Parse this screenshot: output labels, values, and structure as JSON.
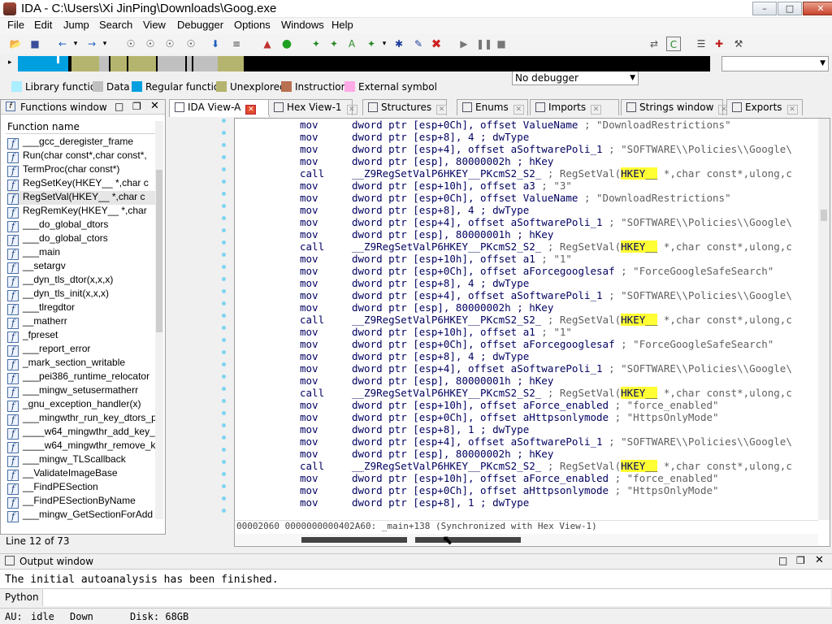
{
  "window": {
    "title": "IDA - C:\\Users\\Xi JinPing\\Downloads\\Goog.exe"
  },
  "menu": [
    "File",
    "Edit",
    "Jump",
    "Search",
    "View",
    "Debugger",
    "Options",
    "Windows",
    "Help"
  ],
  "toolbar": {
    "debugger_select": "No debugger"
  },
  "legend": [
    {
      "label": "Library function",
      "color": "#aaeeff"
    },
    {
      "label": "Data",
      "color": "#c0c0c0"
    },
    {
      "label": "Regular function",
      "color": "#00a0e0"
    },
    {
      "label": "Unexplored",
      "color": "#b4b46e"
    },
    {
      "label": "Instruction",
      "color": "#b87050"
    },
    {
      "label": "External symbol",
      "color": "#ffaae6"
    }
  ],
  "functions_window": {
    "title": "Functions window",
    "column": "Function name",
    "items": [
      "___gcc_deregister_frame",
      "Run(char const*,char const*,",
      "TermProc(char const*)",
      "RegSetKey(HKEY__ *,char c",
      "RegSetVal(HKEY__ *,char c",
      "RegRemKey(HKEY__ *,char",
      "___do_global_dtors",
      "___do_global_ctors",
      "___main",
      "__setargv",
      "__dyn_tls_dtor(x,x,x)",
      "__dyn_tls_init(x,x,x)",
      "___tlregdtor",
      "__matherr",
      "_fpreset",
      "___report_error",
      "_mark_section_writable",
      "___pei386_runtime_relocator",
      "___mingw_setusermatherr",
      "_gnu_exception_handler(x)",
      "___mingwthr_run_key_dtors_p",
      "____w64_mingwthr_add_key_",
      "____w64_mingwthr_remove_k",
      "___mingw_TLScallback",
      "__ValidateImageBase",
      "__FindPESection",
      "__FindPESectionByName",
      "___mingw_GetSectionForAdd"
    ],
    "status": "Line 12 of 73"
  },
  "tabs": [
    {
      "label": "IDA View-A",
      "icon": "ida-view-icon"
    },
    {
      "label": "Hex View-1",
      "icon": "hex-view-icon"
    },
    {
      "label": "Structures",
      "icon": "structures-icon"
    },
    {
      "label": "Enums",
      "icon": "enums-icon"
    },
    {
      "label": "Imports",
      "icon": "imports-icon"
    },
    {
      "label": "Strings window",
      "icon": "strings-icon"
    },
    {
      "label": "Exports",
      "icon": "exports-icon"
    }
  ],
  "disassembly": [
    {
      "m": "mov",
      "o": "dword ptr [esp+0Ch], offset ValueName",
      "c": " ; \"DownloadRestrictions\""
    },
    {
      "m": "mov",
      "o": "dword ptr [esp+8], 4 ; dwType",
      "c": ""
    },
    {
      "m": "mov",
      "o": "dword ptr [esp+4], offset aSoftwarePoli_1",
      "c": " ; \"SOFTWARE\\\\Policies\\\\Google\\"
    },
    {
      "m": "mov",
      "o": "dword ptr [esp], 80000002h ; hKey",
      "c": ""
    },
    {
      "m": "call",
      "o": "__Z9RegSetValP6HKEY__PKcmS2_S2_",
      "c": " ; RegSetVal(",
      "h": "HKEY__",
      "t": " *,char const*,ulong,c"
    },
    {
      "m": "mov",
      "o": "dword ptr [esp+10h], offset a3",
      "c": " ; \"3\""
    },
    {
      "m": "mov",
      "o": "dword ptr [esp+0Ch], offset ValueName",
      "c": " ; \"DownloadRestrictions\""
    },
    {
      "m": "mov",
      "o": "dword ptr [esp+8], 4 ; dwType",
      "c": ""
    },
    {
      "m": "mov",
      "o": "dword ptr [esp+4], offset aSoftwarePoli_1",
      "c": " ; \"SOFTWARE\\\\Policies\\\\Google\\"
    },
    {
      "m": "mov",
      "o": "dword ptr [esp], 80000001h ; hKey",
      "c": ""
    },
    {
      "m": "call",
      "o": "__Z9RegSetValP6HKEY__PKcmS2_S2_",
      "c": " ; RegSetVal(",
      "h": "HKEY__",
      "t": " *,char const*,ulong,c"
    },
    {
      "m": "mov",
      "o": "dword ptr [esp+10h], offset a1",
      "c": " ; \"1\""
    },
    {
      "m": "mov",
      "o": "dword ptr [esp+0Ch], offset aForcegooglesaf",
      "c": " ; \"ForceGoogleSafeSearch\""
    },
    {
      "m": "mov",
      "o": "dword ptr [esp+8], 4 ; dwType",
      "c": ""
    },
    {
      "m": "mov",
      "o": "dword ptr [esp+4], offset aSoftwarePoli_1",
      "c": " ; \"SOFTWARE\\\\Policies\\\\Google\\"
    },
    {
      "m": "mov",
      "o": "dword ptr [esp], 80000002h ; hKey",
      "c": ""
    },
    {
      "m": "call",
      "o": "__Z9RegSetValP6HKEY__PKcmS2_S2_",
      "c": " ; RegSetVal(",
      "h": "HKEY__",
      "t": " *,char const*,ulong,c"
    },
    {
      "m": "mov",
      "o": "dword ptr [esp+10h], offset a1",
      "c": " ; \"1\""
    },
    {
      "m": "mov",
      "o": "dword ptr [esp+0Ch], offset aForcegooglesaf",
      "c": " ; \"ForceGoogleSafeSearch\""
    },
    {
      "m": "mov",
      "o": "dword ptr [esp+8], 4 ; dwType",
      "c": ""
    },
    {
      "m": "mov",
      "o": "dword ptr [esp+4], offset aSoftwarePoli_1",
      "c": " ; \"SOFTWARE\\\\Policies\\\\Google\\"
    },
    {
      "m": "mov",
      "o": "dword ptr [esp], 80000001h ; hKey",
      "c": ""
    },
    {
      "m": "call",
      "o": "__Z9RegSetValP6HKEY__PKcmS2_S2_",
      "c": " ; RegSetVal(",
      "h": "HKEY__",
      "t": " *,char const*,ulong,c"
    },
    {
      "m": "mov",
      "o": "dword ptr [esp+10h], offset aForce_enabled",
      "c": " ; \"force_enabled\""
    },
    {
      "m": "mov",
      "o": "dword ptr [esp+0Ch], offset aHttpsonlymode",
      "c": " ; \"HttpsOnlyMode\""
    },
    {
      "m": "mov",
      "o": "dword ptr [esp+8], 1 ; dwType",
      "c": ""
    },
    {
      "m": "mov",
      "o": "dword ptr [esp+4], offset aSoftwarePoli_1",
      "c": " ; \"SOFTWARE\\\\Policies\\\\Google\\"
    },
    {
      "m": "mov",
      "o": "dword ptr [esp], 80000002h ; hKey",
      "c": ""
    },
    {
      "m": "call",
      "o": "__Z9RegSetValP6HKEY__PKcmS2_S2_",
      "c": " ; RegSetVal(",
      "h": "HKEY__",
      "t": " *,char const*,ulong,c"
    },
    {
      "m": "mov",
      "o": "dword ptr [esp+10h], offset aForce_enabled",
      "c": " ; \"force_enabled\""
    },
    {
      "m": "mov",
      "o": "dword ptr [esp+0Ch], offset aHttpsonlymode",
      "c": " ; \"HttpsOnlyMode\""
    },
    {
      "m": "mov",
      "o": "dword ptr [esp+8], 1 ; dwType",
      "c": ""
    }
  ],
  "disasm_status": "00002060 0000000000402A60: _main+138 (Synchronized with Hex View-1)",
  "output": {
    "title": "Output window",
    "text": "The initial autoanalysis has been finished.",
    "prompt": "Python"
  },
  "status": {
    "au_label": "AU:",
    "au": "idle",
    "dir": "Down",
    "disk": "Disk: 68GB"
  }
}
